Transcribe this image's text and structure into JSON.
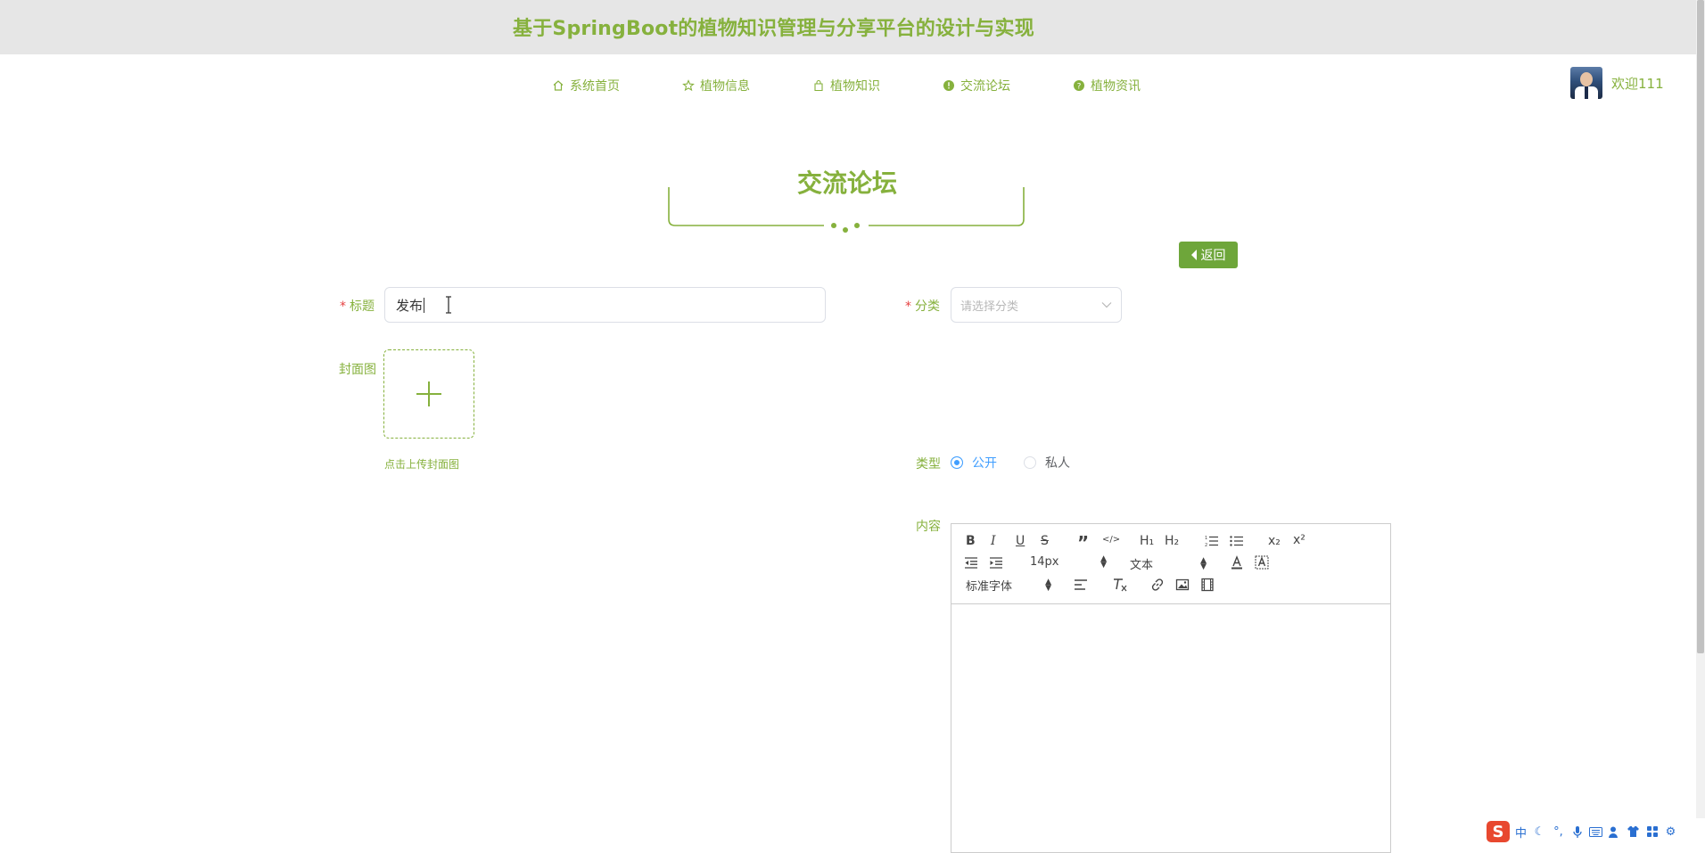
{
  "site": {
    "title": "基于SpringBoot的植物知识管理与分享平台的设计与实现"
  },
  "nav": {
    "items": [
      {
        "label": "系统首页",
        "icon": "home-icon"
      },
      {
        "label": "植物信息",
        "icon": "star-icon"
      },
      {
        "label": "植物知识",
        "icon": "bag-icon"
      },
      {
        "label": "交流论坛",
        "icon": "info-circle-icon"
      },
      {
        "label": "植物资讯",
        "icon": "question-circle-icon"
      }
    ]
  },
  "user": {
    "welcome": "欢迎111"
  },
  "page": {
    "section_title": "交流论坛",
    "back_label": "返回"
  },
  "form": {
    "title_label": "标题",
    "title_value": "发布",
    "category_label": "分类",
    "category_placeholder": "请选择分类",
    "cover_label": "封面图",
    "cover_hint": "点击上传封面图",
    "type_label": "类型",
    "type_options": [
      "公开",
      "私人"
    ],
    "type_selected": "公开",
    "content_label": "内容"
  },
  "editor": {
    "toolbar": {
      "bold": "B",
      "italic": "I",
      "underline": "U",
      "strike": "S",
      "quote": "”",
      "code": "</>",
      "h1": "H₁",
      "h2": "H₂",
      "subscript": "x₂",
      "superscript": "x²",
      "font_size": "14px",
      "header_select": "文本",
      "font_family": "标准字体"
    }
  },
  "tray": {
    "ime_label": "中"
  },
  "colors": {
    "brand": "#86b13d",
    "button": "#6ea63a",
    "radio_active": "#409eff"
  }
}
